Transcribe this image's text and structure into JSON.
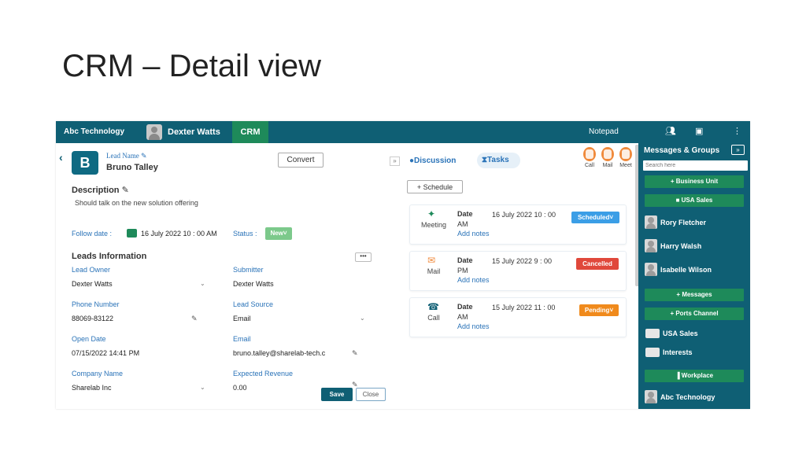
{
  "slide": {
    "title": "CRM – Detail view"
  },
  "topbar": {
    "company": "Abc Technology",
    "user_name": "Dexter Watts",
    "active_tab": "CRM",
    "notepad": "Notepad"
  },
  "lead": {
    "avatar_letter": "B",
    "name_label": "Lead Name",
    "name": "Bruno Talley",
    "convert_label": "Convert"
  },
  "description": {
    "title": "Description",
    "text": "Should talk on the new solution offering"
  },
  "follow": {
    "label": "Follow date :",
    "value": "16 July 2022 10 : 00 AM",
    "status_label": "Status :",
    "status_value": "New"
  },
  "leads_info": {
    "title": "Leads Information",
    "more": "•••",
    "fields": [
      {
        "label": "Lead Owner",
        "value": "Dexter Watts"
      },
      {
        "label": "Submitter",
        "value": "Dexter Watts"
      },
      {
        "label": "Phone Number",
        "value": "88069-83122"
      },
      {
        "label": "Lead Source",
        "value": "Email"
      },
      {
        "label": "Open Date",
        "value": "07/15/2022 14:41 PM"
      },
      {
        "label": "Email",
        "value": "bruno.talley@sharelab-tech.c"
      },
      {
        "label": "Company Name",
        "value": "Sharelab Inc"
      },
      {
        "label": "Expected Revenue",
        "value": "0.00"
      }
    ],
    "save_label": "Save",
    "close_label": "Close"
  },
  "tasks_panel": {
    "tab_discussion": "Discussion",
    "tab_tasks": "Tasks",
    "actions": [
      "Call",
      "Mail",
      "Meet"
    ],
    "schedule_label": "+ Schedule",
    "date_label": "Date",
    "add_notes": "Add notes",
    "items": [
      {
        "type": "Meeting",
        "date": "16 July 2022 10 : 00",
        "ampm": "AM",
        "status": "Scheduled",
        "color": "#3b9ee6"
      },
      {
        "type": "Mail",
        "date": "15 July 2022 9 : 00",
        "ampm": "PM",
        "status": "Cancelled",
        "color": "#e0483b"
      },
      {
        "type": "Call",
        "date": "15 July 2022 11 : 00",
        "ampm": "AM",
        "status": "Pending",
        "color": "#f08a1c"
      }
    ]
  },
  "right_panel": {
    "title": "Messages & Groups",
    "search_placeholder": "Search here",
    "business_unit": "+ Business Unit",
    "usa_sales_btn": "USA Sales",
    "people": [
      "Rory Fletcher",
      "Harry Walsh",
      "Isabelle Wilson"
    ],
    "messages_btn": "+ Messages",
    "ports_channel_btn": "+ Ports Channel",
    "groups": [
      "USA Sales",
      "Interests"
    ],
    "workplace_btn": "Workplace",
    "company_group": "Abc Technology"
  },
  "colors": {
    "primary": "#0f5f74",
    "accent_green": "#1e8a5a",
    "link_blue": "#2a73b8"
  }
}
